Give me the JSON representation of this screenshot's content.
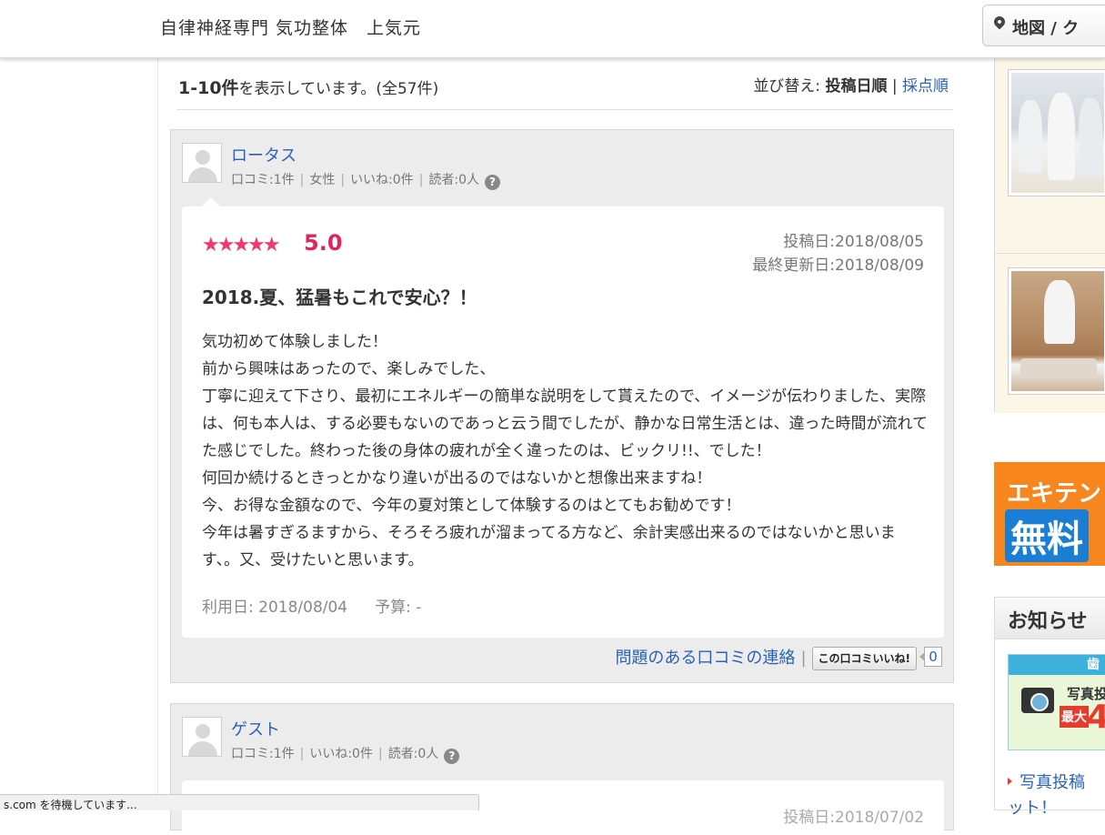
{
  "header": {
    "site_title": "自律神経専門 気功整体　上気元",
    "map_button": "地図 / ク",
    "map_icon": "map-pin-icon"
  },
  "results": {
    "range": "1-10件",
    "shown_text": "を表示しています。(全57件)",
    "sort_label": "並び替え:",
    "sort_current": "投稿日順",
    "sort_separator": "|",
    "sort_alt": "採点順"
  },
  "reviews": [
    {
      "user_name": "ロータス",
      "meta": [
        "口コミ:1件",
        "女性",
        "いいね:0件",
        "読者:0人"
      ],
      "meta_sep": "|",
      "stars": "★★★★★",
      "score": "5.0",
      "posted": "投稿日:2018/08/05",
      "updated": "最終更新日:2018/08/09",
      "title": "2018.夏、猛暑もこれで安心？！",
      "body": [
        "気功初めて体験しました！",
        "前から興味はあったので、楽しみでした、",
        "丁寧に迎えて下さり、最初にエネルギーの簡単な説明をして貰えたので、イメージが伝わりました、実際は、何も本人は、する必要もないのであっと云う間でしたが、静かな日常生活とは、違った時間が流れてた感じでした。終わった後の身体の疲れが全く違ったのは、ビックリ!!、でした！",
        "何回か続けるときっとかなり違いが出るのではないかと想像出来ますね！",
        "今、お得な金額なので、今年の夏対策として体験するのはとてもお勧めです！",
        "今年は暑すぎるますから、そろそろ疲れが溜まってる方など、余計実感出来るのではないかと思います、。又、受けたいと思います。"
      ],
      "usage_date": "利用日: 2018/08/04",
      "budget": "予算: -",
      "report_link": "問題のある口コミの連絡",
      "like_button": "この口コミいいね!",
      "like_count": "0"
    },
    {
      "user_name": "ゲスト",
      "meta": [
        "口コミ:1件",
        "いいね:0件",
        "読者:0人"
      ],
      "meta_sep": "|",
      "posted": "投稿日:2018/07/02"
    }
  ],
  "sidebar": {
    "banner_line1": "エキテン",
    "banner_line2": "無料",
    "notice_heading": "お知らせ",
    "notice_img_top": "歯",
    "notice_img_text": "写真投",
    "notice_img_badge": "最大",
    "notice_img_big": "4",
    "notice_link": "写真投稿",
    "notice_link_cont": "ット！"
  },
  "statusbar": {
    "text": "s.com を待機しています..."
  },
  "colors": {
    "link": "#2962b8",
    "star": "#ee3b6e",
    "score": "#e0245e",
    "banner": "#f7861e"
  }
}
